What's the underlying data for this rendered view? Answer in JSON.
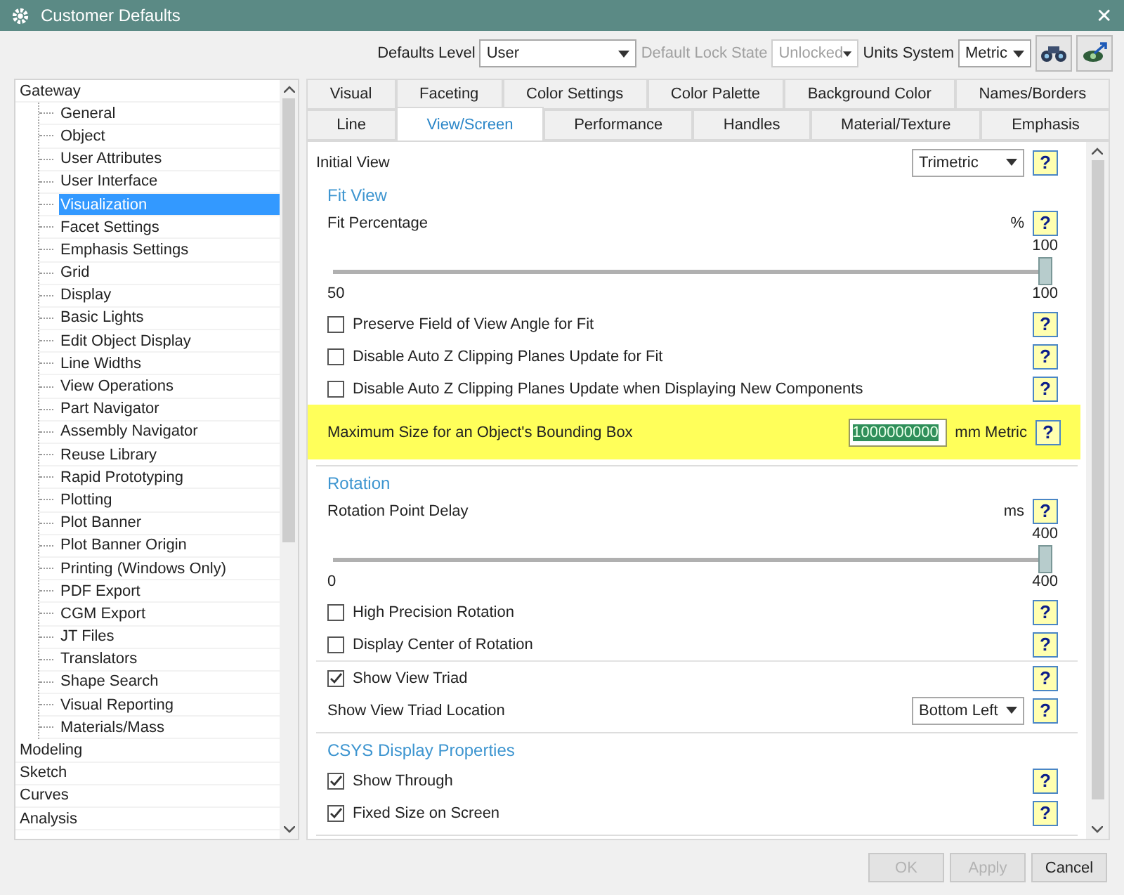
{
  "window": {
    "title": "Customer Defaults",
    "close": "✕"
  },
  "toolbar": {
    "fields": [
      {
        "label": "Defaults Level",
        "value": "User",
        "disabled": false
      },
      {
        "label": "Default Lock State",
        "value": "Unlocked",
        "disabled": true
      },
      {
        "label": "Units System",
        "value": "Metric",
        "disabled": false
      }
    ]
  },
  "sidebar": {
    "items": [
      {
        "label": "Gateway",
        "selected": false,
        "children": [
          {
            "label": "General",
            "selected": false
          },
          {
            "label": "Object",
            "selected": false
          },
          {
            "label": "User Attributes",
            "selected": false
          },
          {
            "label": "User Interface",
            "selected": false
          },
          {
            "label": "Visualization",
            "selected": true
          },
          {
            "label": "Facet Settings",
            "selected": false
          },
          {
            "label": "Emphasis Settings",
            "selected": false
          },
          {
            "label": "Grid",
            "selected": false
          },
          {
            "label": "Display",
            "selected": false
          },
          {
            "label": "Basic Lights",
            "selected": false
          },
          {
            "label": "Edit Object Display",
            "selected": false
          },
          {
            "label": "Line Widths",
            "selected": false
          },
          {
            "label": "View Operations",
            "selected": false
          },
          {
            "label": "Part Navigator",
            "selected": false
          },
          {
            "label": "Assembly Navigator",
            "selected": false
          },
          {
            "label": "Reuse Library",
            "selected": false
          },
          {
            "label": "Rapid Prototyping",
            "selected": false
          },
          {
            "label": "Plotting",
            "selected": false
          },
          {
            "label": "Plot Banner",
            "selected": false
          },
          {
            "label": "Plot Banner Origin",
            "selected": false
          },
          {
            "label": "Printing (Windows Only)",
            "selected": false
          },
          {
            "label": "PDF Export",
            "selected": false
          },
          {
            "label": "CGM Export",
            "selected": false
          },
          {
            "label": "JT Files",
            "selected": false
          },
          {
            "label": "Translators",
            "selected": false
          },
          {
            "label": "Shape Search",
            "selected": false
          },
          {
            "label": "Visual Reporting",
            "selected": false
          },
          {
            "label": "Materials/Mass",
            "selected": false
          }
        ]
      },
      {
        "label": "Modeling",
        "selected": false
      },
      {
        "label": "Sketch",
        "selected": false
      },
      {
        "label": "Curves",
        "selected": false
      },
      {
        "label": "Analysis",
        "selected": false
      }
    ]
  },
  "tabs": [
    [
      {
        "label": "Visual",
        "selected": false
      },
      {
        "label": "Faceting",
        "selected": false
      },
      {
        "label": "Color Settings",
        "selected": false
      },
      {
        "label": "Color Palette",
        "selected": false
      },
      {
        "label": "Background Color",
        "selected": false
      },
      {
        "label": "Names/Borders",
        "selected": false
      }
    ],
    [
      {
        "label": "Line",
        "selected": false
      },
      {
        "label": "View/Screen",
        "selected": true
      },
      {
        "label": "Performance",
        "selected": false
      },
      {
        "label": "Handles",
        "selected": false
      },
      {
        "label": "Material/Texture",
        "selected": false
      },
      {
        "label": "Emphasis",
        "selected": false
      }
    ]
  ],
  "content": {
    "top": {
      "kind": "dropdown",
      "label": "Initial View",
      "value": "Trimetric",
      "help": "?"
    },
    "sections": [
      {
        "title": "Fit View",
        "items": [
          {
            "kind": "slider",
            "label": "Fit Percentage",
            "unit": "%",
            "help": "?",
            "value_label": "100",
            "min": "50",
            "max": "100",
            "level": 1
          },
          {
            "kind": "checkbox",
            "label": "Preserve Field of View Angle for Fit",
            "checked": false,
            "help": "?"
          },
          {
            "kind": "checkbox",
            "label": "Disable Auto Z Clipping Planes Update for Fit",
            "checked": false,
            "help": "?"
          },
          {
            "kind": "checkbox",
            "label": "Disable Auto Z Clipping Planes Update when Displaying New Components",
            "checked": false,
            "help": "?"
          },
          {
            "kind": "field",
            "label": "Maximum Size for an Object's Bounding Box",
            "value": "1000000000",
            "unit": "mm Metric",
            "text_selected": true,
            "highlighted": true,
            "help": "?"
          }
        ]
      },
      {
        "title": "Rotation",
        "items": [
          {
            "kind": "slider",
            "label": "Rotation Point Delay",
            "unit": "ms",
            "help": "?",
            "value_label": "400",
            "min": "0",
            "max": "400",
            "level": 1
          },
          {
            "kind": "checkbox",
            "label": "High Precision Rotation",
            "checked": false,
            "help": "?"
          },
          {
            "kind": "checkbox",
            "label": "Display Center of Rotation",
            "checked": false,
            "help": "?"
          },
          {
            "kind": "checkbox",
            "label": "Show View Triad",
            "checked": true,
            "separated": true,
            "help": "?"
          },
          {
            "kind": "dropdown",
            "label": "Show View Triad Location",
            "value": "Bottom Left",
            "help": "?"
          }
        ]
      },
      {
        "title": "CSYS Display Properties",
        "items": [
          {
            "kind": "checkbox",
            "label": "Show Through",
            "checked": true,
            "help": "?"
          },
          {
            "kind": "checkbox",
            "label": "Fixed Size on Screen",
            "checked": true,
            "help": "?"
          }
        ]
      }
    ]
  },
  "buttons": [
    {
      "label": "OK",
      "disabled": true
    },
    {
      "label": "Apply",
      "disabled": true
    },
    {
      "label": "Cancel",
      "disabled": false
    }
  ]
}
